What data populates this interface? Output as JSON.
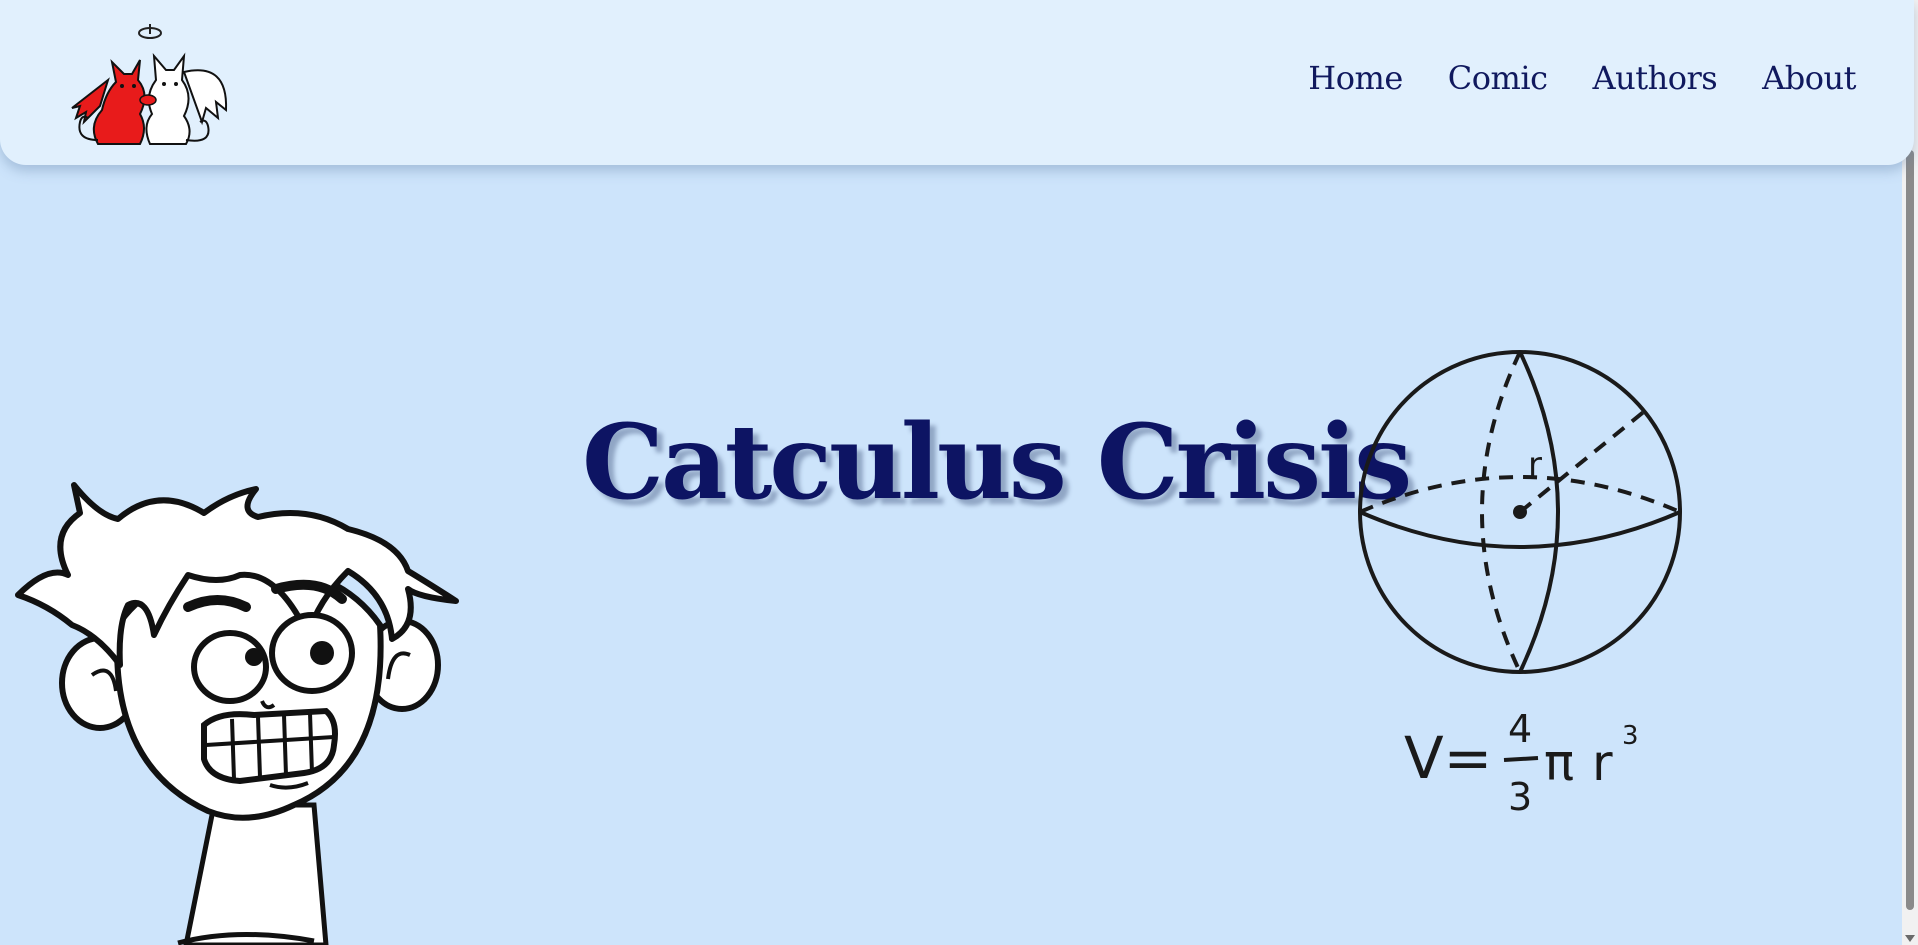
{
  "header": {
    "logo_icon": "devil-and-angel-cats-logo-icon",
    "nav": [
      {
        "label": "Home"
      },
      {
        "label": "Comic"
      },
      {
        "label": "Authors"
      },
      {
        "label": "About"
      }
    ]
  },
  "hero": {
    "title": "Catculus Crisis",
    "character_icon": "nervous-boy-illustration",
    "sphere_icon": "sphere-radius-diagram",
    "sphere_label": "r",
    "formula": {
      "lhs": "V=",
      "numerator": "4",
      "denominator": "3",
      "pi": "π",
      "var": "r",
      "exponent": "3"
    }
  },
  "colors": {
    "background": "#cde4fb",
    "header": "#e1f0fd",
    "nav_text": "#10195e",
    "title": "#0d1463"
  }
}
